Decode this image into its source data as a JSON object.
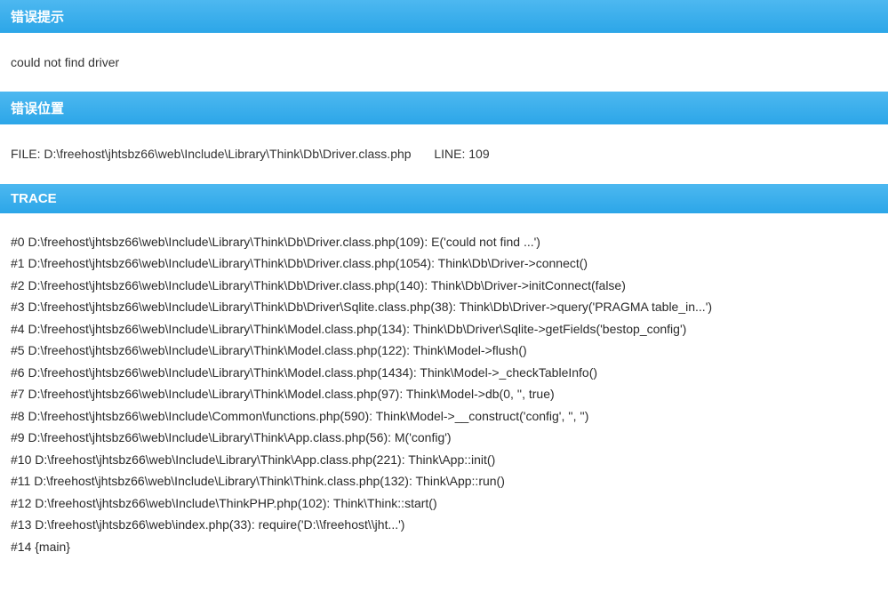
{
  "sections": {
    "error_hint": {
      "title": "错误提示",
      "message": "could not find driver"
    },
    "error_location": {
      "title": "错误位置",
      "file_label": "FILE:",
      "file_path": "D:\\freehost\\jhtsbz66\\web\\Include\\Library\\Think\\Db\\Driver.class.php",
      "line_label": "LINE:",
      "line_number": "109"
    },
    "trace": {
      "title": "TRACE",
      "lines": [
        "#0 D:\\freehost\\jhtsbz66\\web\\Include\\Library\\Think\\Db\\Driver.class.php(109): E('could not find ...')",
        "#1 D:\\freehost\\jhtsbz66\\web\\Include\\Library\\Think\\Db\\Driver.class.php(1054): Think\\Db\\Driver->connect()",
        "#2 D:\\freehost\\jhtsbz66\\web\\Include\\Library\\Think\\Db\\Driver.class.php(140): Think\\Db\\Driver->initConnect(false)",
        "#3 D:\\freehost\\jhtsbz66\\web\\Include\\Library\\Think\\Db\\Driver\\Sqlite.class.php(38): Think\\Db\\Driver->query('PRAGMA table_in...')",
        "#4 D:\\freehost\\jhtsbz66\\web\\Include\\Library\\Think\\Model.class.php(134): Think\\Db\\Driver\\Sqlite->getFields('bestop_config')",
        "#5 D:\\freehost\\jhtsbz66\\web\\Include\\Library\\Think\\Model.class.php(122): Think\\Model->flush()",
        "#6 D:\\freehost\\jhtsbz66\\web\\Include\\Library\\Think\\Model.class.php(1434): Think\\Model->_checkTableInfo()",
        "#7 D:\\freehost\\jhtsbz66\\web\\Include\\Library\\Think\\Model.class.php(97): Think\\Model->db(0, '', true)",
        "#8 D:\\freehost\\jhtsbz66\\web\\Include\\Common\\functions.php(590): Think\\Model->__construct('config', '', '')",
        "#9 D:\\freehost\\jhtsbz66\\web\\Include\\Library\\Think\\App.class.php(56): M('config')",
        "#10 D:\\freehost\\jhtsbz66\\web\\Include\\Library\\Think\\App.class.php(221): Think\\App::init()",
        "#11 D:\\freehost\\jhtsbz66\\web\\Include\\Library\\Think\\Think.class.php(132): Think\\App::run()",
        "#12 D:\\freehost\\jhtsbz66\\web\\Include\\ThinkPHP.php(102): Think\\Think::start()",
        "#13 D:\\freehost\\jhtsbz66\\web\\index.php(33): require('D:\\\\freehost\\\\jht...')",
        "#14 {main}"
      ]
    }
  }
}
